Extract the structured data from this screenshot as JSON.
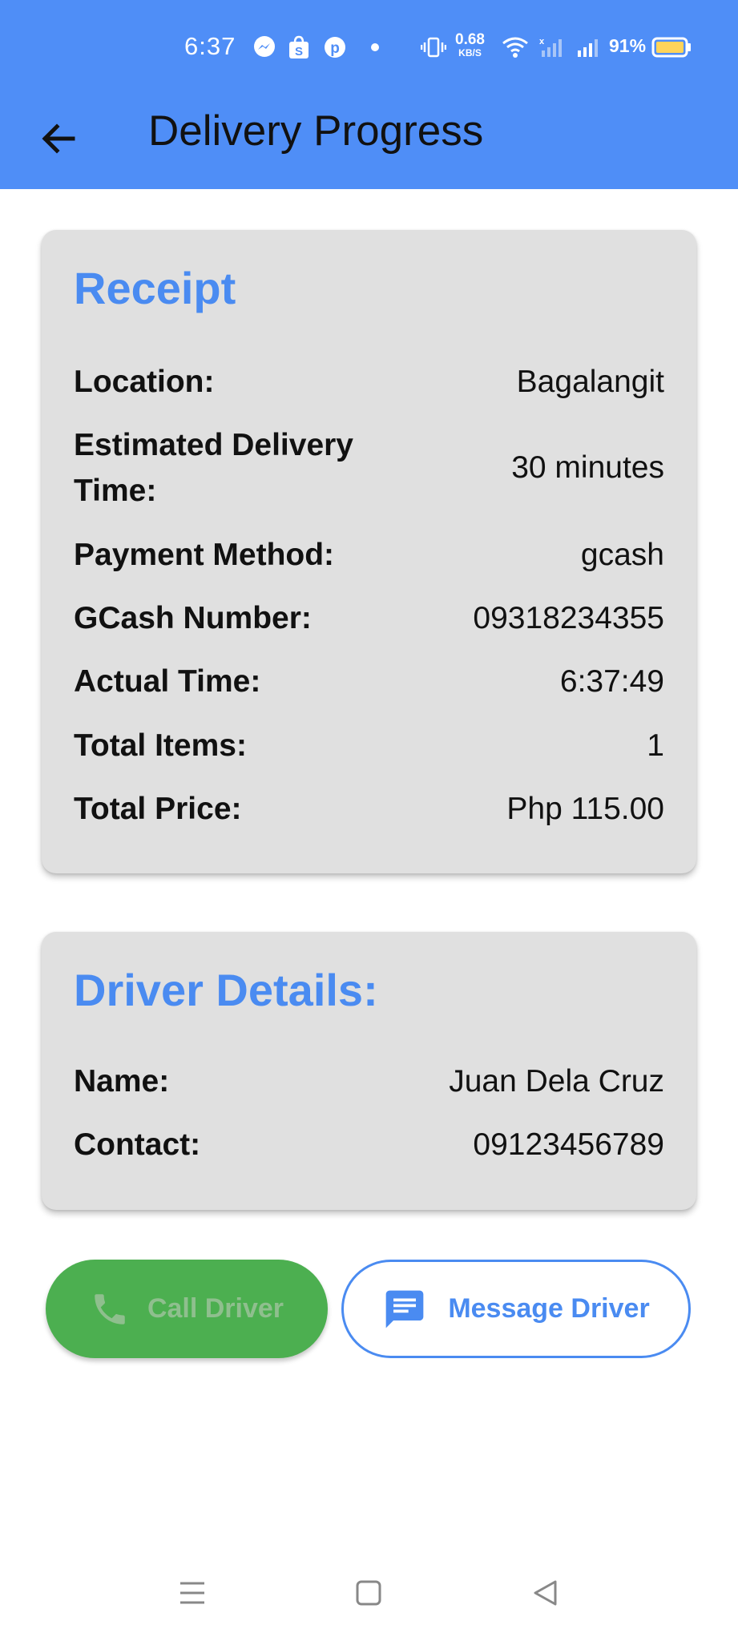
{
  "status_bar": {
    "time": "6:37",
    "net_speed_value": "0.68",
    "net_speed_unit": "KB/S",
    "battery_percent": "91%",
    "icons": [
      "messenger-icon",
      "shopee-icon",
      "pinterest-icon",
      "dot-icon",
      "vibrate-icon",
      "wifi-icon",
      "signal-off-icon",
      "signal-icon",
      "battery-icon"
    ]
  },
  "app_bar": {
    "title": "Delivery Progress",
    "back_icon": "arrow-back-icon",
    "color": "#4f8ef7"
  },
  "receipt": {
    "title": "Receipt",
    "rows": [
      {
        "label": "Location:",
        "value": "Bagalangit"
      },
      {
        "label": "Estimated Delivery Time:",
        "value": "30 minutes"
      },
      {
        "label": "Payment Method:",
        "value": "gcash"
      },
      {
        "label": "GCash Number:",
        "value": "09318234355"
      },
      {
        "label": "Actual Time:",
        "value": "6:37:49"
      },
      {
        "label": "Total Items:",
        "value": "1"
      },
      {
        "label": "Total Price:",
        "value": "Php 115.00"
      }
    ]
  },
  "driver": {
    "title": "Driver Details:",
    "rows": [
      {
        "label": "Name:",
        "value": "Juan Dela Cruz"
      },
      {
        "label": "Contact:",
        "value": "09123456789"
      }
    ]
  },
  "actions": {
    "call_label": "Call Driver",
    "call_icon": "phone-icon",
    "call_color": "#4caf50",
    "message_label": "Message Driver",
    "message_icon": "message-icon",
    "accent": "#4a8bf1"
  },
  "nav": {
    "icons": [
      "menu-icon",
      "home-square-icon",
      "back-triangle-icon"
    ]
  }
}
